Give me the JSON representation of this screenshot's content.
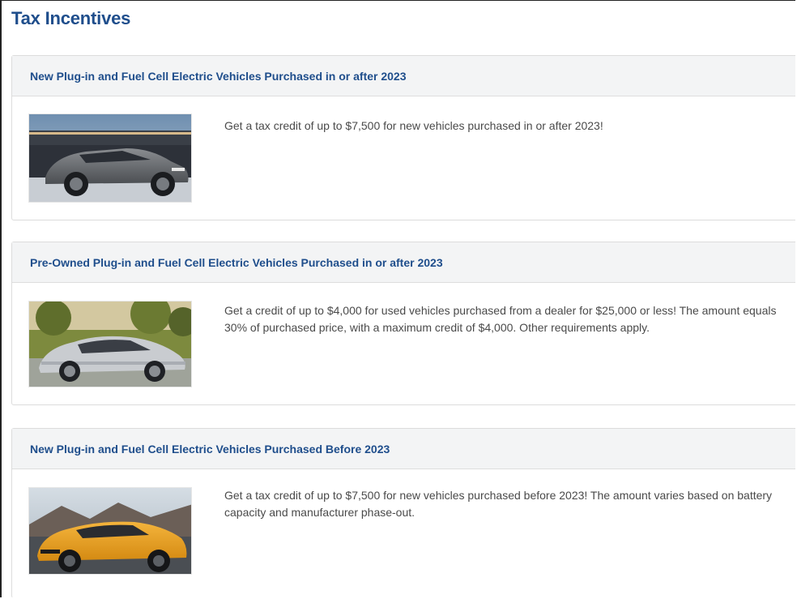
{
  "page": {
    "title": "Tax Incentives"
  },
  "cards": [
    {
      "title": "New Plug-in and Fuel Cell Electric Vehicles Purchased in or after 2023",
      "description": "Get a tax credit of up to $7,500 for new vehicles purchased in or after 2023!",
      "image": "gray-electric-suv-photo"
    },
    {
      "title": "Pre-Owned Plug-in and Fuel Cell Electric Vehicles Purchased in or after 2023",
      "description": "Get a credit of up to $4,000 for used vehicles purchased from a dealer for $25,000 or less! The amount equals 30% of purchased price, with a maximum credit of $4,000. Other requirements apply.",
      "image": "silver-hatchback-photo"
    },
    {
      "title": "New Plug-in and Fuel Cell Electric Vehicles Purchased Before 2023",
      "description": "Get a tax credit of up to $7,500 for new vehicles purchased before 2023! The amount varies based on battery capacity and manufacturer phase-out.",
      "image": "yellow-electric-suv-photo"
    }
  ],
  "colors": {
    "title": "#1f4e8c",
    "header_bg": "#f3f4f5",
    "body_text": "#4a4a4a"
  }
}
